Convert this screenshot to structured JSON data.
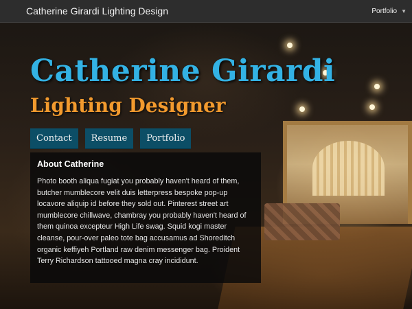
{
  "navbar": {
    "brand": "Catherine Girardi Lighting Design",
    "menu_label": "Portfolio",
    "menu_icon": "chevron-down-icon"
  },
  "hero": {
    "name": "Catherine Girardi",
    "role": "Lighting Designer",
    "name_color": "#33b2e4",
    "role_color": "#f29a2e"
  },
  "buttons": [
    {
      "label": "Contact"
    },
    {
      "label": "Resume"
    },
    {
      "label": "Portfolio"
    }
  ],
  "button_color": "#0c4e66",
  "about": {
    "title": "About Catherine",
    "body": "Photo booth aliqua fugiat you probably haven't heard of them, butcher mumblecore velit duis letterpress bespoke pop-up locavore aliquip id before they sold out. Pinterest street art mumblecore chillwave, chambray you probably haven't heard of them quinoa excepteur High Life swag. Squid kogi master cleanse, pour-over paleo tote bag accusamus ad Shoreditch organic keffiyeh Portland raw denim messenger bag. Proident Terry Richardson tattooed magna cray incididunt."
  }
}
